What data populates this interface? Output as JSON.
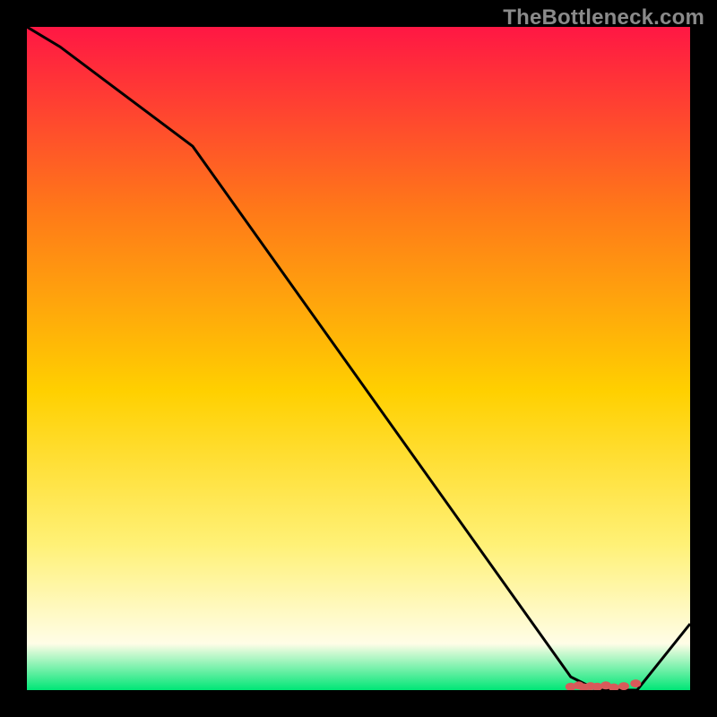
{
  "watermark": "TheBottleneck.com",
  "colors": {
    "gradient_top": "#ff1744",
    "gradient_upper_mid": "#ff7a18",
    "gradient_mid": "#ffd000",
    "gradient_lower_mid": "#fff176",
    "gradient_cream": "#fffde7",
    "gradient_bottom": "#00e676",
    "line": "#000000",
    "marker": "#d85a5a",
    "frame": "#000000"
  },
  "chart_data": {
    "type": "line",
    "title": "",
    "xlabel": "",
    "ylabel": "",
    "xlim": [
      0,
      100
    ],
    "ylim": [
      0,
      100
    ],
    "series": [
      {
        "name": "curve",
        "x": [
          0,
          5,
          25,
          82,
          86,
          92,
          100
        ],
        "values": [
          100,
          97,
          82,
          2,
          0,
          0,
          10
        ]
      }
    ],
    "flat_segment": {
      "x_start": 82,
      "x_end": 92,
      "y": 0
    },
    "markers": {
      "name": "cluster",
      "points": [
        {
          "x": 82.0,
          "y": 0.5
        },
        {
          "x": 83.2,
          "y": 0.7
        },
        {
          "x": 84.0,
          "y": 0.4
        },
        {
          "x": 85.0,
          "y": 0.6
        },
        {
          "x": 86.0,
          "y": 0.5
        },
        {
          "x": 87.3,
          "y": 0.7
        },
        {
          "x": 88.5,
          "y": 0.4
        },
        {
          "x": 90.0,
          "y": 0.6
        },
        {
          "x": 91.8,
          "y": 1.0
        }
      ]
    }
  }
}
